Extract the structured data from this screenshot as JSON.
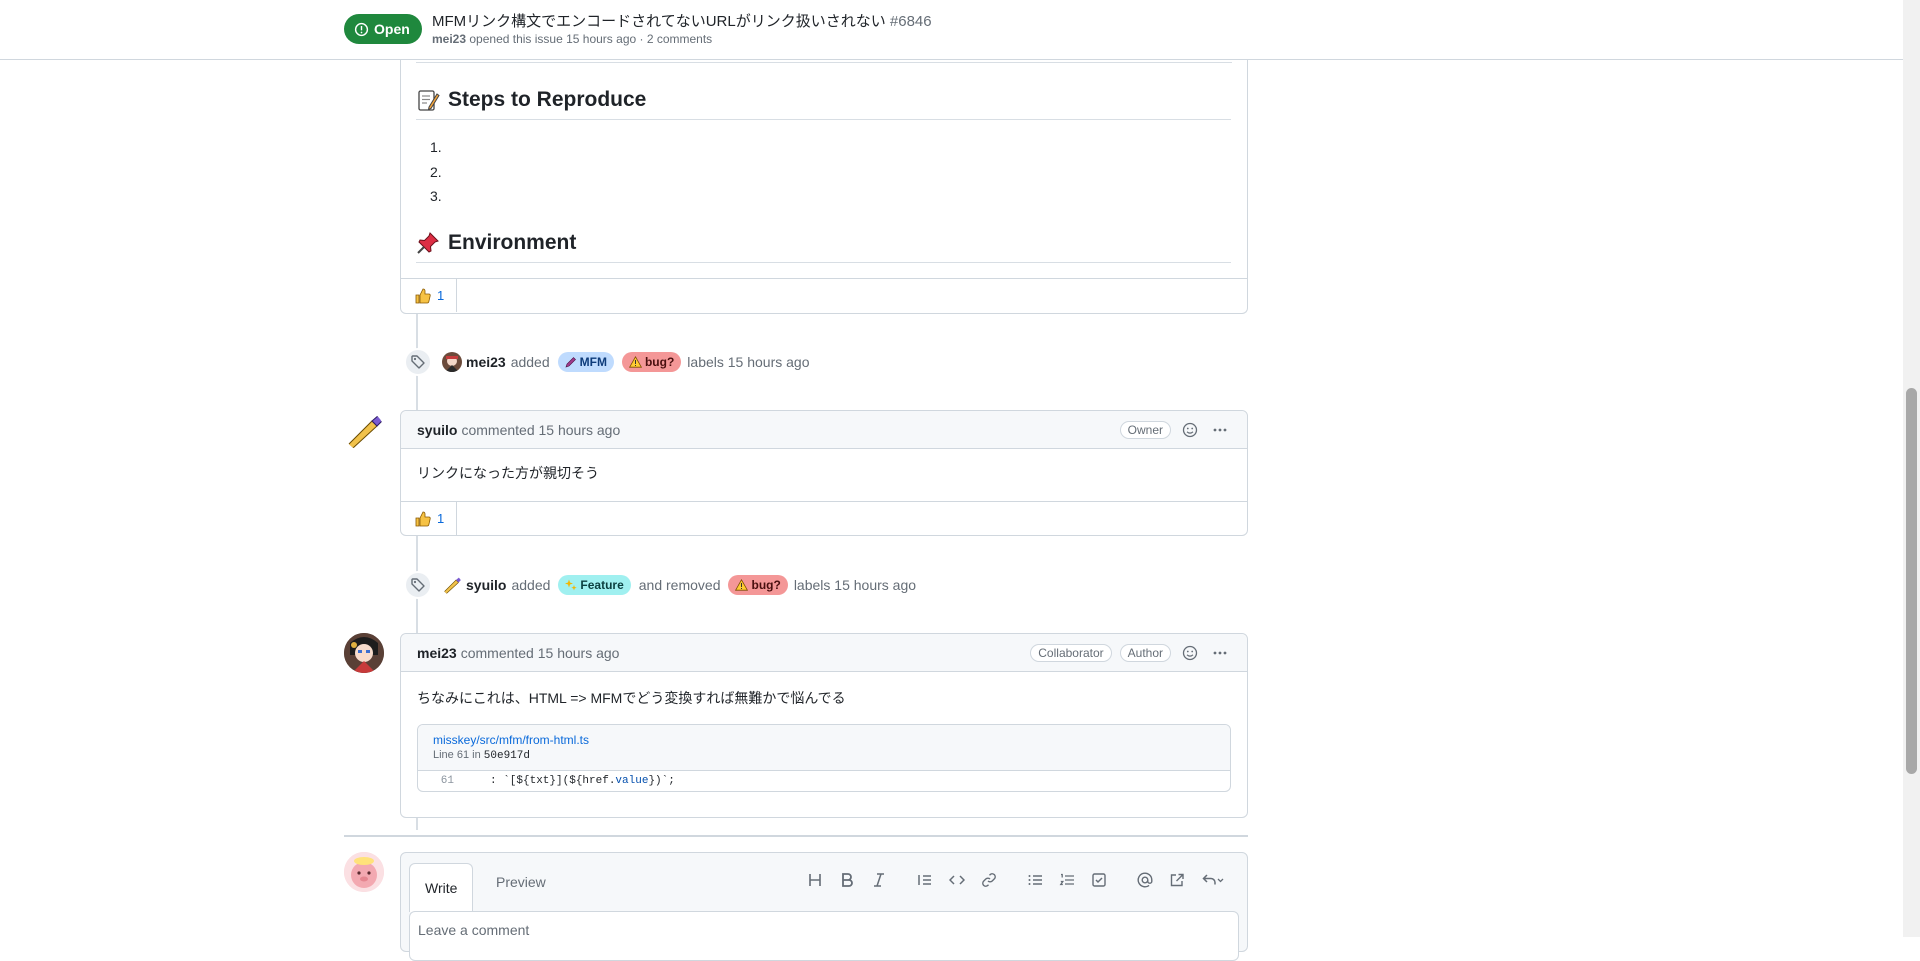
{
  "sticky_header": {
    "state": "Open",
    "title": "MFMリンク構文でエンコードされてないURLがリンク扱いされない",
    "number": "#6846",
    "author": "mei23",
    "meta": "opened this issue 15 hours ago · 2 comments"
  },
  "first_comment": {
    "steps_heading": "Steps to Reproduce",
    "steps_items": [
      "1.",
      "2.",
      "3."
    ],
    "environment_heading": "Environment",
    "reaction_count": "1"
  },
  "event_1": {
    "actor": "mei23",
    "verb": "added",
    "labels": [
      {
        "name": "MFM",
        "bg": "#bfdbfe",
        "fg": "#0d3b7a"
      },
      {
        "name": "bug?",
        "bg": "#f49797",
        "fg": "#4a0f0f"
      }
    ],
    "suffix": "labels 15 hours ago"
  },
  "comment_2": {
    "author": "syuilo",
    "meta": "commented 15 hours ago",
    "role": "Owner",
    "body": "リンクになった方が親切そう",
    "reaction_count": "1"
  },
  "event_2": {
    "actor": "syuilo",
    "verb": "added",
    "added_label": {
      "name": "Feature",
      "bg": "#a0f0f0",
      "fg": "#0b3f3f"
    },
    "middle": "and removed",
    "removed_label": {
      "name": "bug?",
      "bg": "#f49797",
      "fg": "#4a0f0f"
    },
    "suffix": "labels 15 hours ago"
  },
  "comment_3": {
    "author": "mei23",
    "meta": "commented 15 hours ago",
    "roles": [
      "Collaborator",
      "Author"
    ],
    "body": "ちなみにこれは、HTML => MFMでどう変換すれば無難かで悩んでる",
    "snippet": {
      "path": "misskey/src/mfm/from-html.ts",
      "line_prefix": "Line 61 in",
      "commit": "50e917d",
      "line_number": "61",
      "code_before": ": `[${txt}](${href.",
      "code_token": "value",
      "code_after": "})`;"
    }
  },
  "composer": {
    "tab_write": "Write",
    "tab_preview": "Preview",
    "placeholder": "Leave a comment"
  },
  "colors": {
    "open_green": "#1f883d",
    "link_blue": "#0969da",
    "border": "#d0d7de"
  }
}
